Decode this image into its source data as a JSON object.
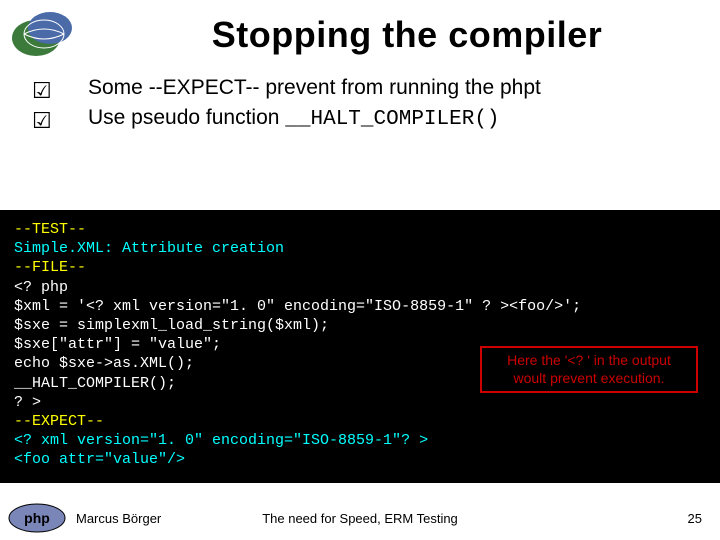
{
  "title": "Stopping the compiler",
  "bullets": [
    {
      "text": "Some --EXPECT-- prevent from running the phpt"
    },
    {
      "prefix": "Use pseudo function ",
      "mono": "__HALT_COMPILER()"
    }
  ],
  "code": {
    "lines": [
      {
        "cls": "c-yellow",
        "text": "--TEST--"
      },
      {
        "cls": "c-cyan",
        "text": "Simple.XML: Attribute creation"
      },
      {
        "cls": "c-yellow",
        "text": "--FILE--"
      },
      {
        "cls": "c-white",
        "text": "<? php"
      },
      {
        "cls": "c-white",
        "text": "$xml = '<? xml version=\"1. 0\" encoding=\"ISO-8859-1\" ? ><foo/>';"
      },
      {
        "cls": "c-white",
        "text": "$sxe = simplexml_load_string($xml);"
      },
      {
        "cls": "c-white",
        "text": "$sxe[\"attr\"] = \"value\";"
      },
      {
        "cls": "c-white",
        "text": "echo $sxe->as.XML();"
      },
      {
        "cls": "c-white",
        "text": "__HALT_COMPILER();"
      },
      {
        "cls": "c-white",
        "text": "? >"
      },
      {
        "cls": "c-yellow",
        "text": "--EXPECT--"
      },
      {
        "cls": "c-cyan",
        "text": "<? xml version=\"1. 0\" encoding=\"ISO-8859-1\"? >"
      },
      {
        "cls": "c-cyan",
        "text": "<foo attr=\"value\"/>"
      }
    ]
  },
  "callout": {
    "line1": "Here the '<? ' in the output",
    "line2": "woult prevent execution."
  },
  "footer": {
    "author": "Marcus Börger",
    "center": "The need for Speed, ERM Testing",
    "page": "25"
  }
}
